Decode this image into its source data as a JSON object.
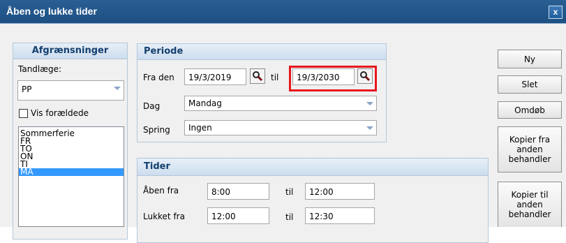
{
  "window": {
    "title": "Åben og lukke tider",
    "close_label": "x"
  },
  "afgraensninger": {
    "header": "Afgrænsninger",
    "tandlaege_label": "Tandlæge:",
    "tandlaege_value": "PP",
    "vis_foraeldede_label": "Vis forældede",
    "vis_foraeldede_checked": false,
    "list_items": [
      "Sommerferie",
      "FR",
      "TO",
      "ON",
      "TI",
      "MA"
    ],
    "selected_item": "MA"
  },
  "periode": {
    "header": "Periode",
    "fra_den_label": "Fra den",
    "fra_den_value": "19/3/2019",
    "til_label": "til",
    "til_value": "19/3/2030",
    "dag_label": "Dag",
    "dag_value": "Mandag",
    "spring_label": "Spring",
    "spring_value": "Ingen"
  },
  "tider": {
    "header": "Tider",
    "aaben_fra_label": "Åben fra",
    "aaben_fra_value": "8:00",
    "aaben_til_label": "til",
    "aaben_til_value": "12:00",
    "lukket_fra_label": "Lukket fra",
    "lukket_fra_value": "12:00",
    "lukket_til_label": "til",
    "lukket_til_value": "12:30"
  },
  "buttons": {
    "ny": "Ny",
    "slet": "Slet",
    "omdoeb": "Omdøb",
    "kopier_fra": "Kopier fra anden behandler",
    "kopier_til": "Kopier til anden behandler"
  },
  "colors": {
    "titlebar": "#1d4f82",
    "selection": "#3399ff",
    "highlight": "#e8151d",
    "group_header_text": "#14406f"
  }
}
